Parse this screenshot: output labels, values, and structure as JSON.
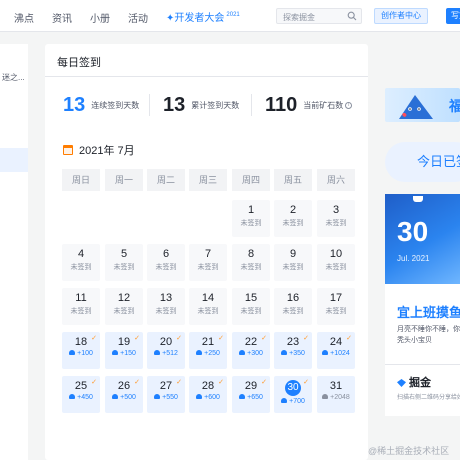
{
  "nav": {
    "items": [
      "沸点",
      "资讯",
      "小册",
      "活动"
    ],
    "event": "开发者大会",
    "event_badge": "2021",
    "search_placeholder": "探索掘金",
    "creator_label": "创作者中心",
    "write_label": "写文"
  },
  "sidebar": {
    "truncated_text": "迷之..."
  },
  "card": {
    "title": "每日签到",
    "stats": [
      {
        "value": "13",
        "label": "连续签到天数"
      },
      {
        "value": "13",
        "label": "累计签到天数"
      },
      {
        "value": "110",
        "label": "当前矿石数"
      }
    ],
    "month": "2021年 7月",
    "weekdays": [
      "周日",
      "周一",
      "周二",
      "周三",
      "周四",
      "周五",
      "周六"
    ],
    "unsigned_label": "未签到",
    "days": [
      {
        "n": "1",
        "col": 4,
        "row": 0
      },
      {
        "n": "2",
        "col": 5,
        "row": 0
      },
      {
        "n": "3",
        "col": 6,
        "row": 0
      },
      {
        "n": "4",
        "col": 0,
        "row": 1
      },
      {
        "n": "5",
        "col": 1,
        "row": 1
      },
      {
        "n": "6",
        "col": 2,
        "row": 1
      },
      {
        "n": "7",
        "col": 3,
        "row": 1
      },
      {
        "n": "8",
        "col": 4,
        "row": 1
      },
      {
        "n": "9",
        "col": 5,
        "row": 1
      },
      {
        "n": "10",
        "col": 6,
        "row": 1
      },
      {
        "n": "11",
        "col": 0,
        "row": 2
      },
      {
        "n": "12",
        "col": 1,
        "row": 2
      },
      {
        "n": "13",
        "col": 2,
        "row": 2
      },
      {
        "n": "14",
        "col": 3,
        "row": 2
      },
      {
        "n": "15",
        "col": 4,
        "row": 2
      },
      {
        "n": "16",
        "col": 5,
        "row": 2
      },
      {
        "n": "17",
        "col": 6,
        "row": 2
      },
      {
        "n": "18",
        "col": 0,
        "row": 3,
        "ore": "+100"
      },
      {
        "n": "19",
        "col": 1,
        "row": 3,
        "ore": "+150"
      },
      {
        "n": "20",
        "col": 2,
        "row": 3,
        "ore": "+512"
      },
      {
        "n": "21",
        "col": 3,
        "row": 3,
        "ore": "+250"
      },
      {
        "n": "22",
        "col": 4,
        "row": 3,
        "ore": "+300"
      },
      {
        "n": "23",
        "col": 5,
        "row": 3,
        "ore": "+350"
      },
      {
        "n": "24",
        "col": 6,
        "row": 3,
        "ore": "+1024"
      },
      {
        "n": "25",
        "col": 0,
        "row": 4,
        "ore": "+450"
      },
      {
        "n": "26",
        "col": 1,
        "row": 4,
        "ore": "+500"
      },
      {
        "n": "27",
        "col": 2,
        "row": 4,
        "ore": "+550"
      },
      {
        "n": "28",
        "col": 3,
        "row": 4,
        "ore": "+600"
      },
      {
        "n": "29",
        "col": 4,
        "row": 4,
        "ore": "+650"
      },
      {
        "n": "30",
        "col": 5,
        "row": 4,
        "ore": "+700",
        "today": true
      },
      {
        "n": "31",
        "col": 6,
        "row": 4,
        "ore": "+2048",
        "future": true
      }
    ]
  },
  "right": {
    "banner_text": "福",
    "today_button": "今日已签到",
    "calendar_day": "30",
    "calendar_date": "Jul. 2021",
    "fortune": "宜上班摸鱼",
    "fortune_desc": "月亮不睡你不睡，你是秃头小宝贝",
    "brand": "掘金",
    "qr_hint": "扫描右侧二维码分享给好友"
  },
  "watermark": "@稀土掘金技术社区",
  "colors": {
    "accent": "#1e80ff",
    "signed_bg": "#eaf2ff",
    "check": "#ff9a2e",
    "calendar_icon": "#ff7d00"
  }
}
